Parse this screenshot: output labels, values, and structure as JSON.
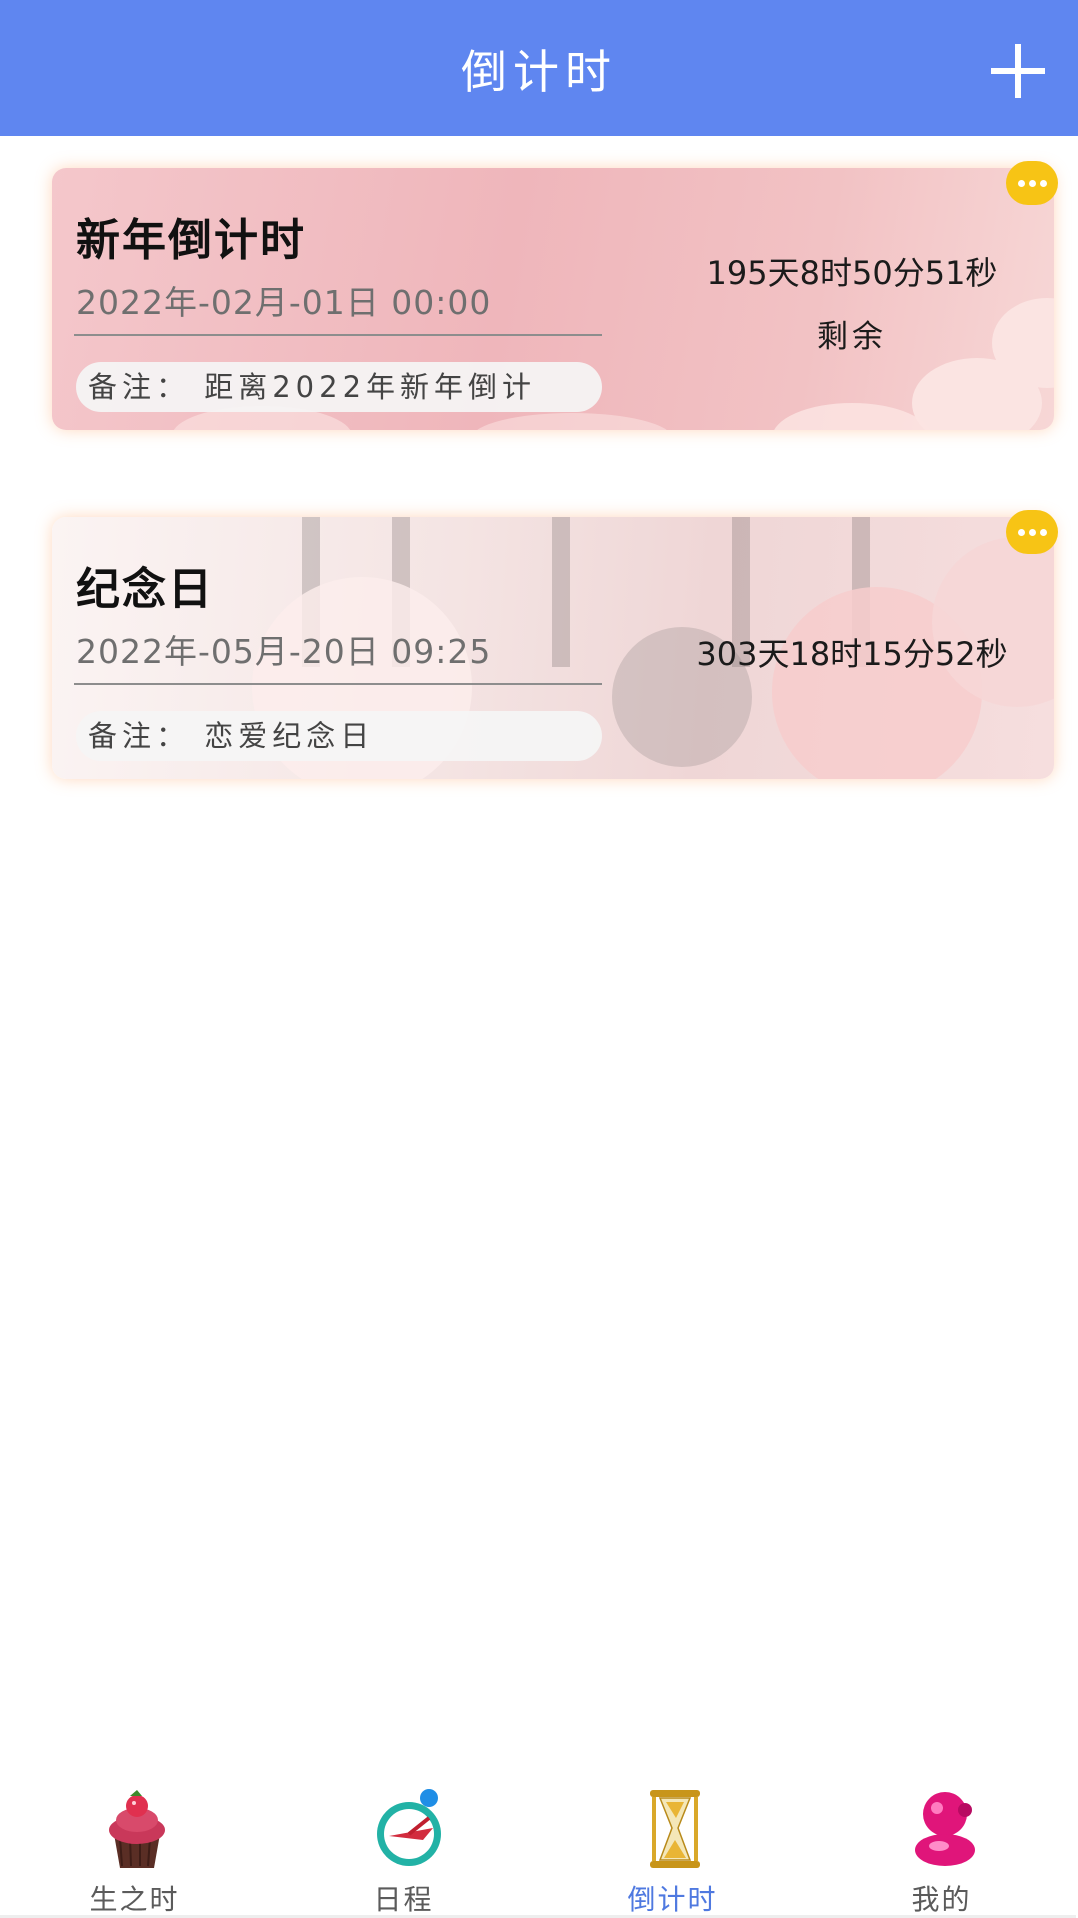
{
  "header": {
    "title": "倒计时",
    "add_icon": "plus-icon"
  },
  "cards": [
    {
      "title": "新年倒计时",
      "date": "2022年-02月-01日 00:00",
      "note": "备注：  距离2022年新年倒计",
      "remaining": "195天8时50分51秒",
      "remaining_label": "剩余",
      "more_icon": "more-dots-icon"
    },
    {
      "title": "纪念日",
      "date": "2022年-05月-20日 09:25",
      "note": "备注：  恋爱纪念日",
      "remaining": "303天18时15分52秒",
      "more_icon": "more-dots-icon"
    }
  ],
  "tabbar": {
    "items": [
      {
        "label": "生之时",
        "icon": "cupcake-icon"
      },
      {
        "label": "日程",
        "icon": "alarm-clock-icon"
      },
      {
        "label": "倒计时",
        "icon": "hourglass-icon",
        "active": true
      },
      {
        "label": "我的",
        "icon": "pink-avatar-icon"
      }
    ]
  },
  "colors": {
    "header": "#5f86f0",
    "active_tab": "#4f79e0",
    "more_button": "#f7c415"
  }
}
